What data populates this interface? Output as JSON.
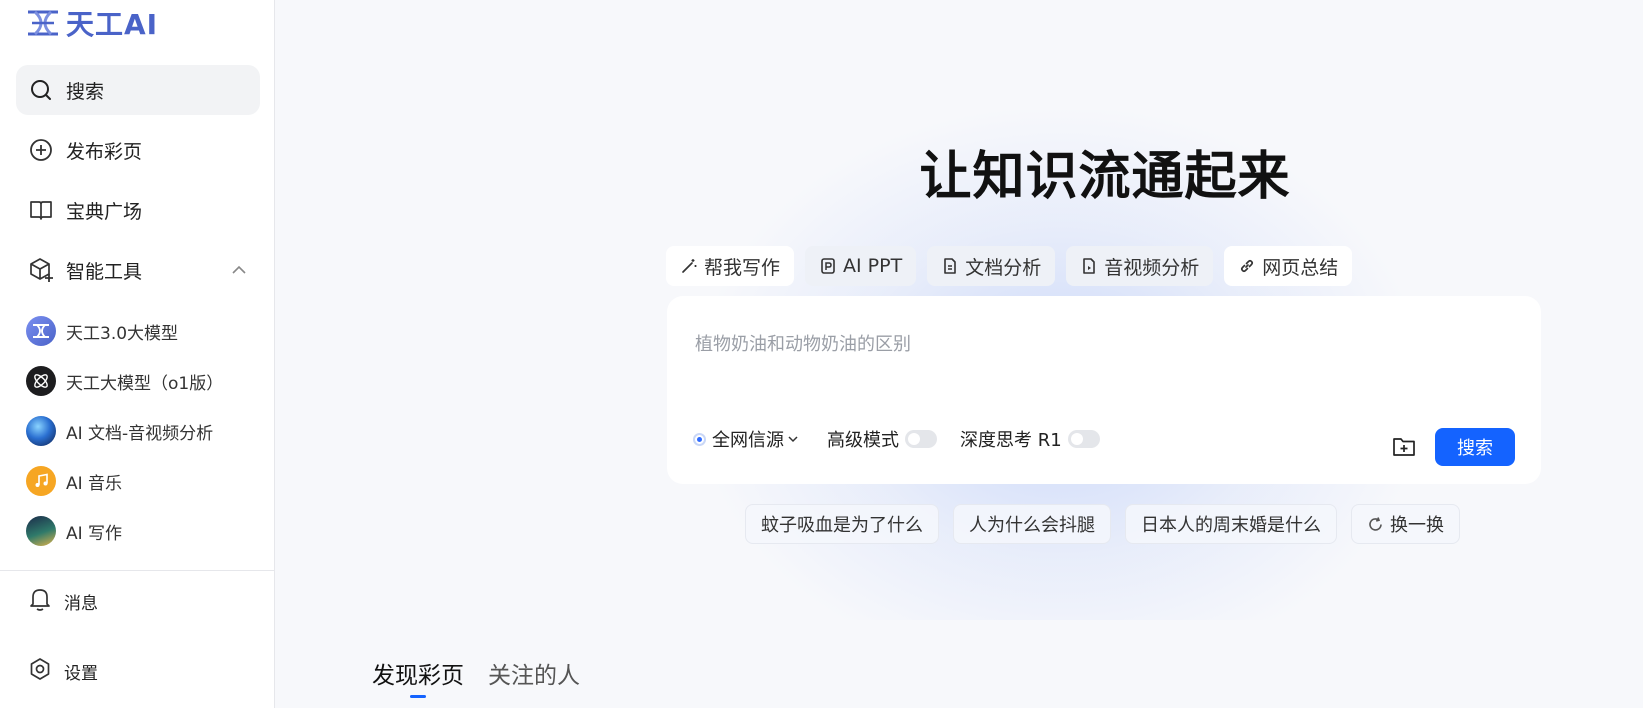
{
  "brand": {
    "name": "天工AI"
  },
  "sidebar": {
    "nav": [
      {
        "label": "搜索",
        "icon": "search-icon"
      },
      {
        "label": "发布彩页",
        "icon": "plus-circle-icon"
      },
      {
        "label": "宝典广场",
        "icon": "book-icon"
      },
      {
        "label": "智能工具",
        "icon": "cube-sparkle-icon",
        "expanded": true
      }
    ],
    "tools": [
      {
        "label": "天工3.0大模型",
        "icon": "tiangong-logo-icon"
      },
      {
        "label": "天工大模型（o1版）",
        "icon": "atom-icon"
      },
      {
        "label": "AI 文档-音视频分析",
        "icon": "document-analysis-avatar"
      },
      {
        "label": "AI 音乐",
        "icon": "music-note-icon"
      },
      {
        "label": "AI 写作",
        "icon": "writing-avatar"
      }
    ],
    "bottom": [
      {
        "label": "消息",
        "icon": "bell-icon"
      },
      {
        "label": "设置",
        "icon": "gear-icon"
      }
    ]
  },
  "main": {
    "hero_title": "让知识流通起来",
    "modes": [
      {
        "label": "帮我写作",
        "icon": "magic-wand-icon",
        "selected": false
      },
      {
        "label": "AI PPT",
        "icon": "ppt-icon",
        "selected": true
      },
      {
        "label": "文档分析",
        "icon": "document-icon",
        "selected": true
      },
      {
        "label": "音视频分析",
        "icon": "media-file-icon",
        "selected": true
      },
      {
        "label": "网页总结",
        "icon": "link-icon",
        "selected": false
      }
    ],
    "search": {
      "placeholder": "植物奶油和动物奶油的区别",
      "source_label": "全网信源",
      "advanced_label": "高级模式",
      "advanced_on": false,
      "deep_think_label": "深度思考 R1",
      "deep_think_on": false,
      "submit_label": "搜索"
    },
    "suggestions": [
      "蚊子吸血是为了什么",
      "人为什么会抖腿",
      "日本人的周末婚是什么"
    ],
    "refresh_label": "换一换",
    "tabs": [
      {
        "label": "发现彩页",
        "active": true
      },
      {
        "label": "关注的人",
        "active": false
      }
    ]
  },
  "colors": {
    "accent": "#1463ff",
    "brand": "#4a63c8"
  }
}
